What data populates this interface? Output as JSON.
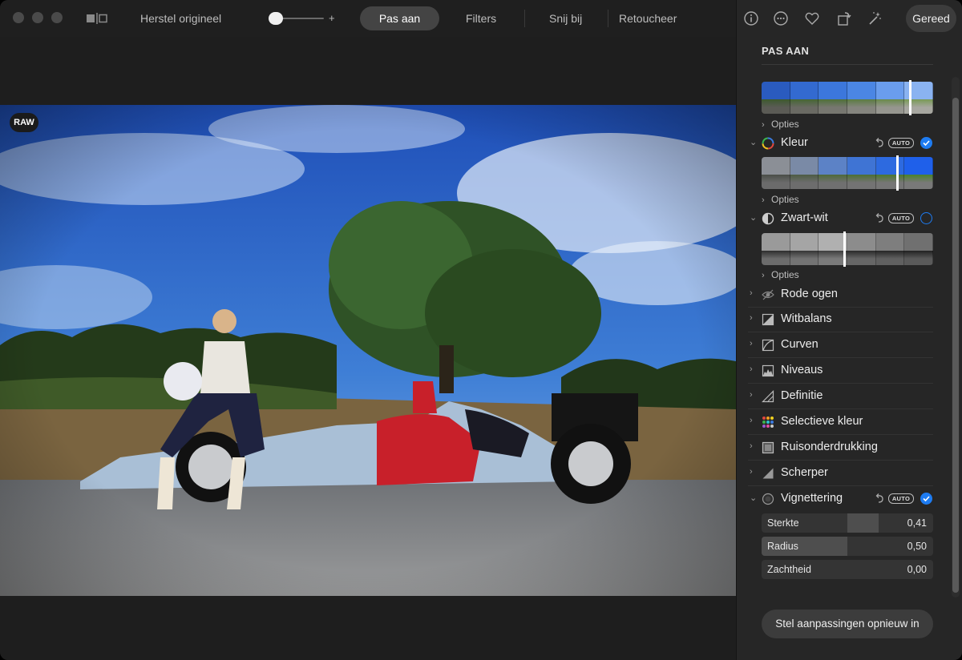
{
  "toolbar": {
    "revert_label": "Herstel origineel",
    "slider_plus": "+",
    "tabs": [
      {
        "label": "Pas aan",
        "active": true
      },
      {
        "label": "Filters",
        "active": false
      },
      {
        "label": "Snij bij",
        "active": false
      },
      {
        "label": "Retoucheer",
        "active": false
      }
    ],
    "done_label": "Gereed",
    "icons": [
      "info-icon",
      "more-icon",
      "heart-icon",
      "rotate-icon",
      "magic-wand-icon"
    ]
  },
  "photo": {
    "badge": "RAW"
  },
  "panel": {
    "title": "PAS AAN",
    "options_label": "Opties",
    "sections": [
      {
        "label": "Kleur",
        "auto": "AUTO",
        "checked": true
      },
      {
        "label": "Zwart-wit",
        "auto": "AUTO",
        "checked": false
      },
      {
        "label": "Rode ogen"
      },
      {
        "label": "Witbalans"
      },
      {
        "label": "Curven"
      },
      {
        "label": "Niveaus"
      },
      {
        "label": "Definitie"
      },
      {
        "label": "Selectieve kleur"
      },
      {
        "label": "Ruisonderdrukking"
      },
      {
        "label": "Scherper"
      },
      {
        "label": "Vignettering",
        "auto": "AUTO",
        "checked": true
      }
    ],
    "vignette_sliders": [
      {
        "label": "Sterkte",
        "value": "0,41",
        "fill": 0.41
      },
      {
        "label": "Radius",
        "value": "0,50",
        "fill": 0.5
      },
      {
        "label": "Zachtheid",
        "value": "0,00",
        "fill": 0.0
      }
    ],
    "reset_label": "Stel aanpassingen opnieuw in"
  },
  "colors": {
    "accent": "#1e7cf2",
    "panel_bg": "#262626",
    "window_bg": "#1e1e1e"
  }
}
